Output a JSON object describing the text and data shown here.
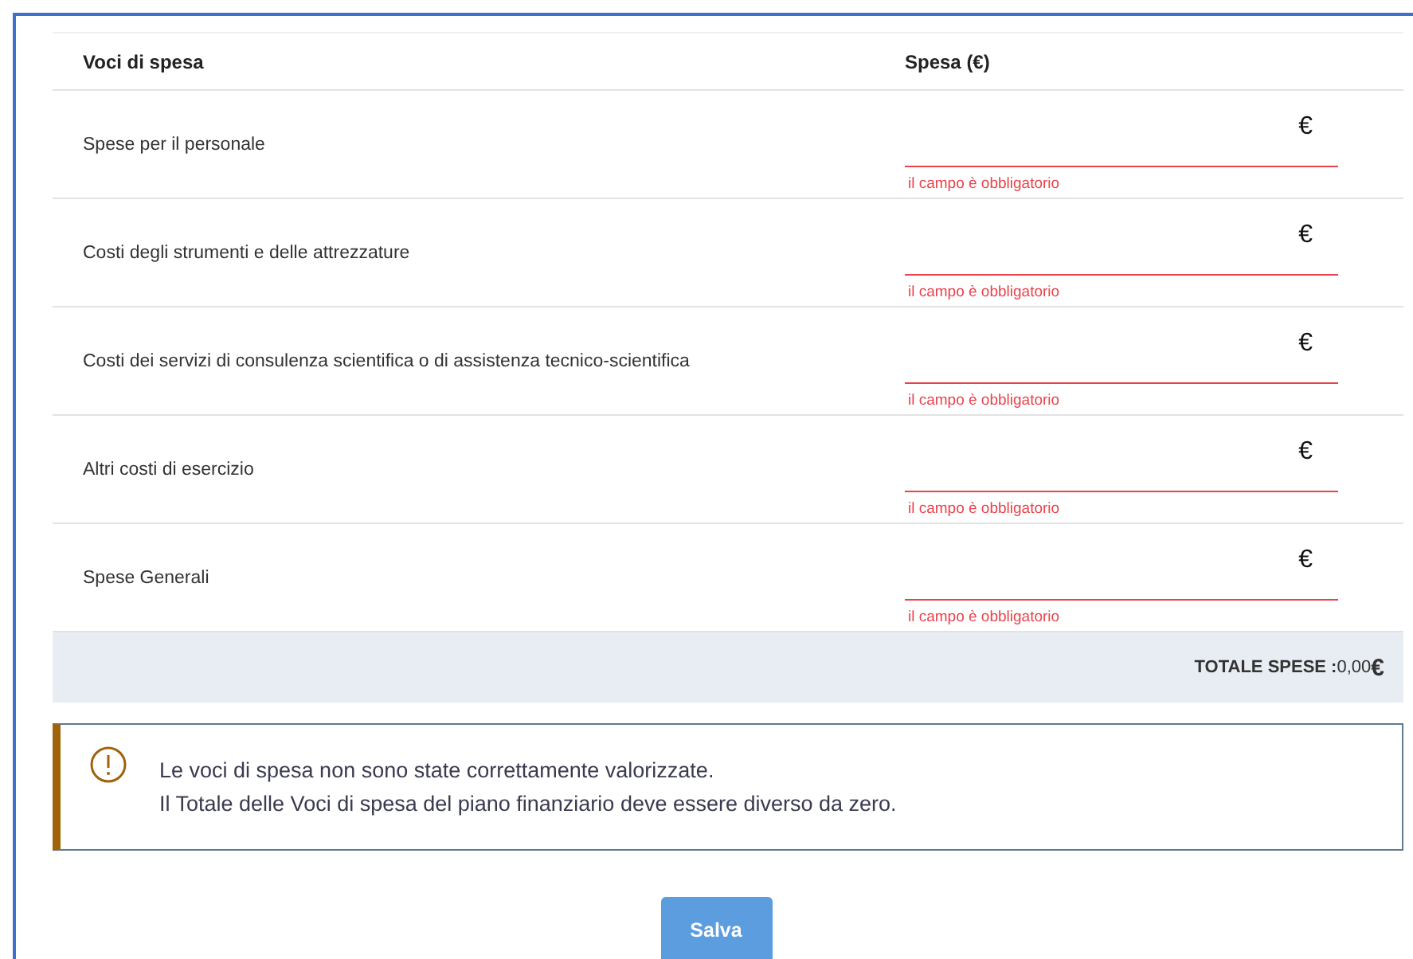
{
  "table": {
    "columns": [
      "Voci di spesa",
      "Spesa (€)"
    ],
    "rows": [
      {
        "label": "Spese per il personale",
        "currency": "€",
        "invalid": true,
        "error": "il campo è obbligatorio"
      },
      {
        "label": "Costi degli strumenti e delle attrezzature",
        "currency": "€",
        "invalid": true,
        "error": "il campo è obbligatorio"
      },
      {
        "label": "Costi dei servizi di consulenza scientifica o di assistenza tecnico-scientifica",
        "currency": "€",
        "invalid": true,
        "error": "il campo è obbligatorio"
      },
      {
        "label": "Altri costi di esercizio",
        "currency": "€",
        "invalid": true,
        "error": "il campo è obbligatorio"
      },
      {
        "label": "Spese Generali",
        "currency": "€",
        "invalid": true,
        "error": "il campo è obbligatorio"
      }
    ],
    "total": {
      "label": "TOTALE SPESE :",
      "value": "0,00",
      "currency": "€"
    }
  },
  "alert": {
    "kind": "warning",
    "lines": [
      "Le voci di spesa non sono state correttamente valorizzate.",
      "Il Totale delle Voci di spesa del piano finanziario deve essere diverso da zero."
    ]
  },
  "save_button": {
    "label": "Salva"
  }
}
